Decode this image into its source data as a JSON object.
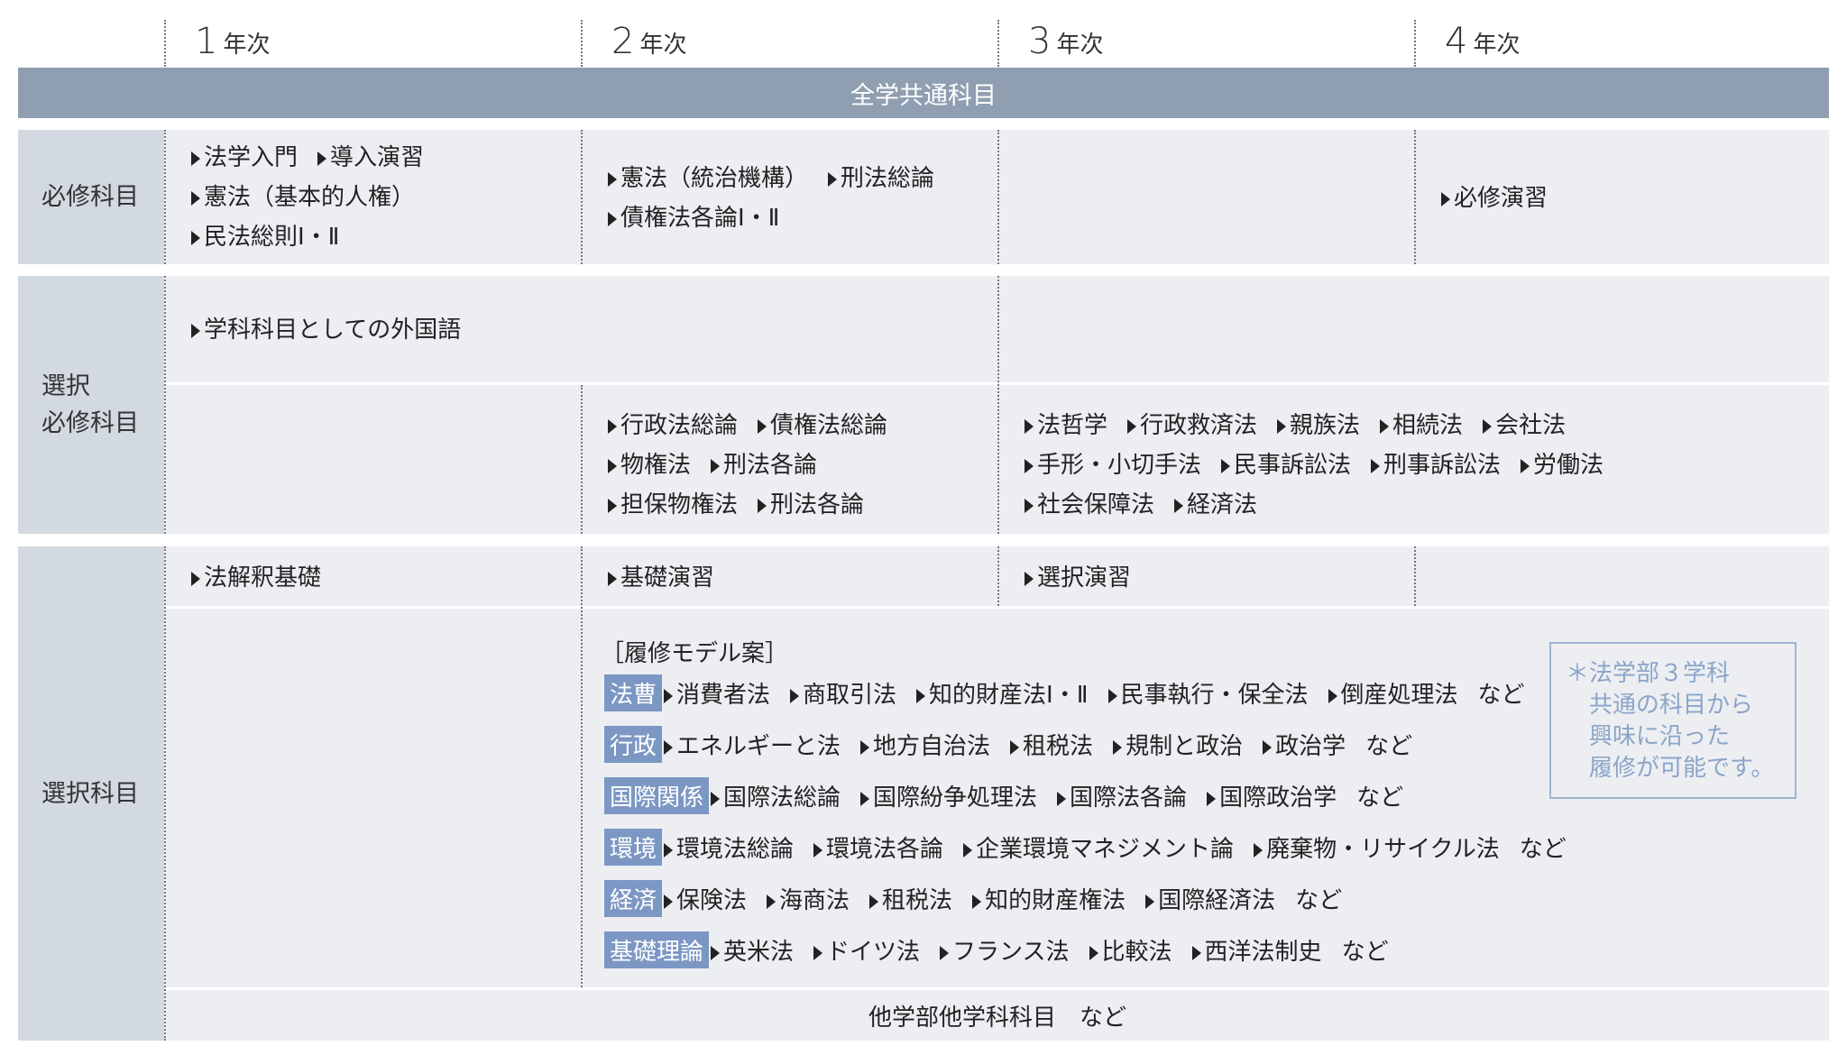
{
  "years": [
    {
      "num": "1",
      "label": "年次"
    },
    {
      "num": "2",
      "label": "年次"
    },
    {
      "num": "3",
      "label": "年次"
    },
    {
      "num": "4",
      "label": "年次"
    }
  ],
  "banner": "全学共通科目",
  "row_heads": {
    "required": "必修科目",
    "selective_required": "選択\n必修科目",
    "elective": "選択科目"
  },
  "required": {
    "y1": [
      [
        "法学入門",
        "導入演習"
      ],
      [
        "憲法（基本的人権）"
      ],
      [
        "民法総則Ⅰ・Ⅱ"
      ]
    ],
    "y2": [
      [
        "憲法（統治機構）",
        "刑法総論"
      ],
      [
        "債権法各論Ⅰ・Ⅱ"
      ]
    ],
    "y4": [
      [
        "必修演習"
      ]
    ]
  },
  "selective": {
    "y12": [
      [
        "学科科目としての外国語"
      ]
    ],
    "y2": [
      [
        "行政法総論",
        "債権法総論"
      ],
      [
        "物権法",
        "刑法各論"
      ],
      [
        "担保物権法",
        "刑法各論"
      ]
    ],
    "y34": [
      [
        "法哲学",
        "行政救済法",
        "親族法",
        "相続法",
        "会社法"
      ],
      [
        "手形・小切手法",
        "民事訴訟法",
        "刑事訴訟法",
        "労働法"
      ],
      [
        "社会保障法",
        "経済法"
      ]
    ]
  },
  "elective": {
    "y1": "法解釈基礎",
    "y2": "基礎演習",
    "y3": "選択演習",
    "model_title": "［履修モデル案］",
    "models": [
      {
        "tag": "法曹",
        "items": [
          "消費者法",
          "商取引法",
          "知的財産法Ⅰ・Ⅱ",
          "民事執行・保全法",
          "倒産処理法"
        ],
        "suffix": "など"
      },
      {
        "tag": "行政",
        "items": [
          "エネルギーと法",
          "地方自治法",
          "租税法",
          "規制と政治",
          "政治学"
        ],
        "suffix": "など"
      },
      {
        "tag": "国際関係",
        "items": [
          "国際法総論",
          "国際紛争処理法",
          "国際法各論",
          "国際政治学"
        ],
        "suffix": "など"
      },
      {
        "tag": "環境",
        "items": [
          "環境法総論",
          "環境法各論",
          "企業環境マネジメント論",
          "廃棄物・リサイクル法"
        ],
        "suffix": "など"
      },
      {
        "tag": "経済",
        "items": [
          "保険法",
          "海商法",
          "租税法",
          "知的財産権法",
          "国際経済法"
        ],
        "suffix": "など"
      },
      {
        "tag": "基礎理論",
        "items": [
          "英米法",
          "ドイツ法",
          "フランス法",
          "比較法",
          "西洋法制史"
        ],
        "suffix": "など"
      }
    ],
    "note": "＊法学部３学科\n　共通の科目から\n　興味に沿った\n　履修が可能です。",
    "other": "他学部他学科科目　など"
  },
  "colors": {
    "tag": "#7c97c3",
    "banner": "#8f9eb0",
    "row_head": "#d3d9e1",
    "cell": "#eceef2",
    "note": "#8ba5c9"
  }
}
